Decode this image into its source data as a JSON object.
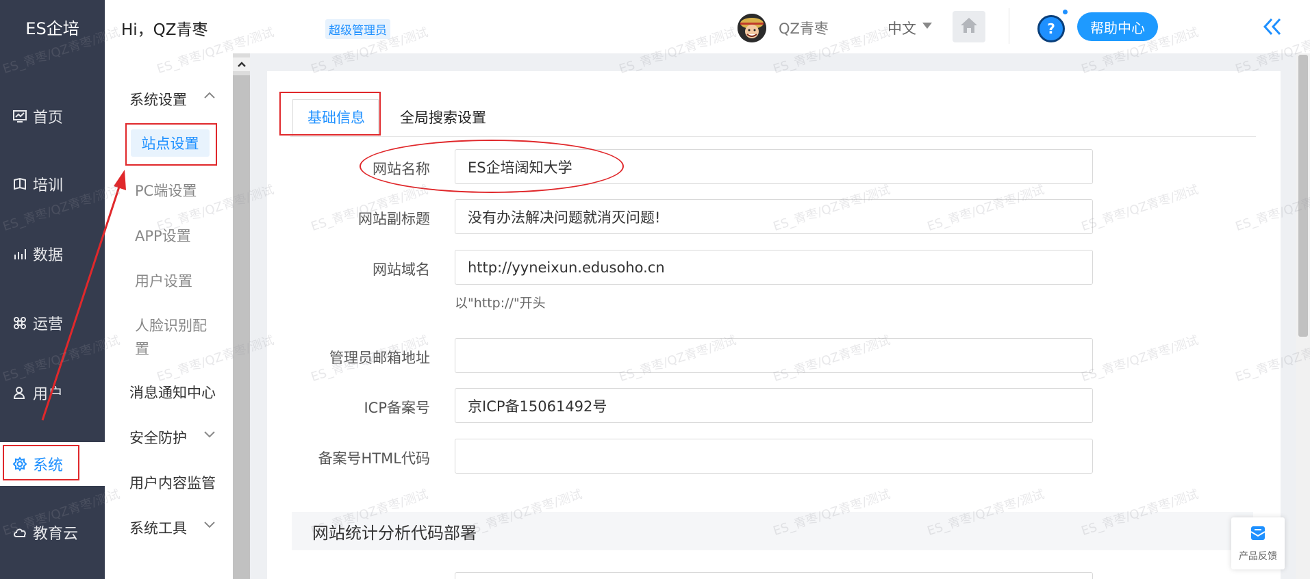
{
  "sidebar": {
    "brand": "ES企培",
    "items": [
      {
        "label": "首页",
        "icon": "dashboard-icon"
      },
      {
        "label": "培训",
        "icon": "training-icon"
      },
      {
        "label": "数据",
        "icon": "chart-icon"
      },
      {
        "label": "运营",
        "icon": "command-icon"
      },
      {
        "label": "用户",
        "icon": "user-icon"
      },
      {
        "label": "系统",
        "icon": "gear-icon"
      },
      {
        "label": "教育云",
        "icon": "cloud-icon"
      }
    ],
    "active": "系统"
  },
  "header": {
    "greeting": "Hi，QZ青枣",
    "role_badge": "超级管理员",
    "username": "QZ青枣",
    "language": "中文",
    "help_label": "帮助中心",
    "help_symbol": "?"
  },
  "submenu": {
    "group_system": "系统设置",
    "items": [
      "站点设置",
      "PC端设置",
      "APP设置",
      "用户设置",
      "人脸识别配置"
    ],
    "face_line1": "人脸识别配",
    "face_line2": "置",
    "message_center": "消息通知中心",
    "security": "安全防护",
    "content_monitor": "用户内容监管",
    "tools": "系统工具"
  },
  "tabs": [
    "基础信息",
    "全局搜索设置"
  ],
  "form": {
    "site_name_label": "网站名称",
    "site_name_value": "ES企培阔知大学",
    "subtitle_label": "网站副标题",
    "subtitle_value": "没有办法解决问题就消灭问题!",
    "domain_label": "网站域名",
    "domain_value": "http://yyneixun.edusoho.cn",
    "domain_hint": "以\"http://\"开头",
    "email_label": "管理员邮箱地址",
    "email_value": "",
    "icp_label": "ICP备案号",
    "icp_value": "京ICP备15061492号",
    "icp_html_label": "备案号HTML代码",
    "icp_html_value": ""
  },
  "section_title": "网站统计分析代码部署",
  "feedback_label": "产品反馈",
  "watermark_text": "ES_青枣/QZ青枣/测试",
  "colors": {
    "sidebar_bg": "#353c4e",
    "accent": "#1e90ff",
    "annotation_red": "#e0282b"
  }
}
